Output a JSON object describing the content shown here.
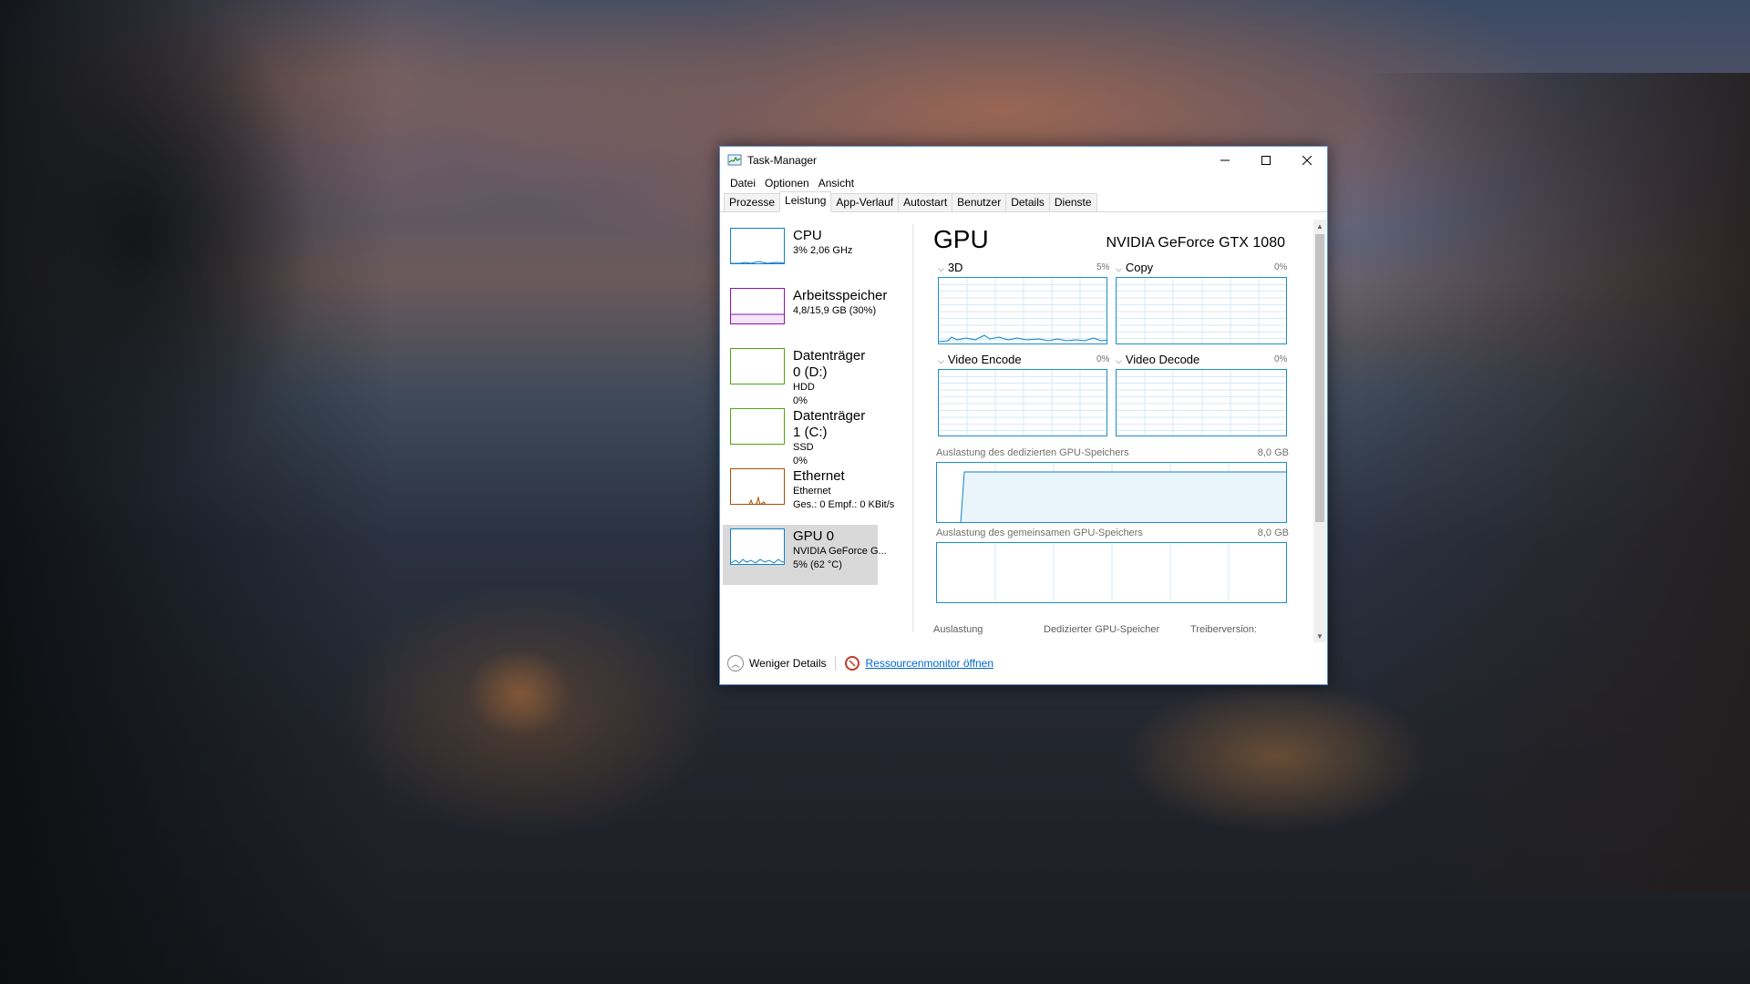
{
  "window": {
    "title": "Task-Manager",
    "controls": {
      "minimize": "—",
      "maximize": "☐",
      "close": "✕"
    }
  },
  "menu": [
    "Datei",
    "Optionen",
    "Ansicht"
  ],
  "tabs": [
    "Prozesse",
    "Leistung",
    "App-Verlauf",
    "Autostart",
    "Benutzer",
    "Details",
    "Dienste"
  ],
  "active_tab": "Leistung",
  "sidebar": {
    "items": [
      {
        "title": "CPU",
        "sub1": "3% 2,06 GHz",
        "sub2": "",
        "color": "#1182c6"
      },
      {
        "title": "Arbeitsspeicher",
        "sub1": "4,8/15,9 GB (30%)",
        "sub2": "",
        "color": "#8b12ae"
      },
      {
        "title": "Datenträger 0 (D:)",
        "sub1": "HDD",
        "sub2": "0%",
        "color": "#4da60c"
      },
      {
        "title": "Datenträger 1 (C:)",
        "sub1": "SSD",
        "sub2": "0%",
        "color": "#4da60c"
      },
      {
        "title": "Ethernet",
        "sub1": "Ethernet",
        "sub2": "Ges.: 0 Empf.: 0 KBit/s",
        "color": "#a74f01"
      },
      {
        "title": "GPU 0",
        "sub1": "NVIDIA GeForce G...",
        "sub2": "5% (62 °C)",
        "color": "#1182c6"
      }
    ],
    "active_index": 5
  },
  "gpu": {
    "title": "GPU",
    "name": "NVIDIA GeForce GTX 1080",
    "engines": [
      {
        "label": "3D",
        "percent": "5%"
      },
      {
        "label": "Copy",
        "percent": "0%"
      },
      {
        "label": "Video Encode",
        "percent": "0%"
      },
      {
        "label": "Video Decode",
        "percent": "0%"
      }
    ],
    "dedicated_label": "Auslastung des dedizierten GPU-Speichers",
    "dedicated_max": "8,0 GB",
    "shared_label": "Auslastung des gemeinsamen GPU-Speichers",
    "shared_max": "8,0 GB",
    "bottom_stats": [
      "Auslastung",
      "Dedizierter GPU-Speicher",
      "Treiberversion:"
    ]
  },
  "footer": {
    "less_details": "Weniger Details",
    "resource_monitor": "Ressourcenmonitor öffnen"
  }
}
